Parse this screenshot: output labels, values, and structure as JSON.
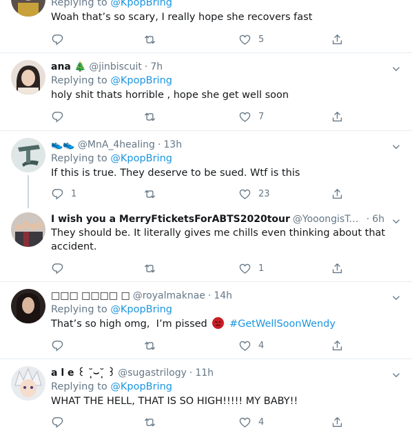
{
  "tweets": [
    {
      "reply_prefix": "Replying to ",
      "reply_to": "@KpopBring",
      "text": "Woah that’s so scary, I really hope she recovers fast",
      "likes": "5"
    },
    {
      "name": "ana",
      "name_emoji": "🎄",
      "handle": "@jinbiscuit",
      "time": "7h",
      "reply_prefix": "Replying to ",
      "reply_to": "@KpopBring",
      "text": "holy shit thats horrible , hope she get well soon",
      "likes": "7"
    },
    {
      "handle": "@MnA_4healing",
      "time": "13h",
      "reply_prefix": "Replying to ",
      "reply_to": "@KpopBring",
      "text": "If this is true. They deserve to be sued. Wtf is this",
      "replies": "1",
      "likes": "23"
    },
    {
      "name": "I wish you a MerryFticketsForABTS2020tour",
      "handle": "@YooongisTong...",
      "time": "6h",
      "text": "They should be. It literally gives me chills even thinking about that accident.",
      "likes": "1"
    },
    {
      "name": "□□□ □□□□ □",
      "handle": "@royalmaknae",
      "time": "14h",
      "reply_prefix": "Replying to ",
      "reply_to": "@KpopBring",
      "text": "That’s so high omg,  I’m pissed ",
      "hashtag": "#GetWellSoonWendy",
      "likes": "4"
    },
    {
      "name": "a l e ꒰ ˘̩̩̩⌣˘̩̩̩ ꒱",
      "handle": "@sugastrilogy",
      "time": "11h",
      "reply_prefix": "Replying to ",
      "reply_to": "@KpopBring",
      "text": "WHAT THE HELL, THAT IS SO HIGH!!!!! MY BABY!!",
      "likes": "4"
    }
  ],
  "colors": {
    "link": "#1b95e0",
    "secondary": "#657786",
    "border": "#e6ecf0"
  },
  "icons": [
    "reply-icon",
    "retweet-icon",
    "like-icon",
    "share-icon",
    "caret-down-icon"
  ]
}
